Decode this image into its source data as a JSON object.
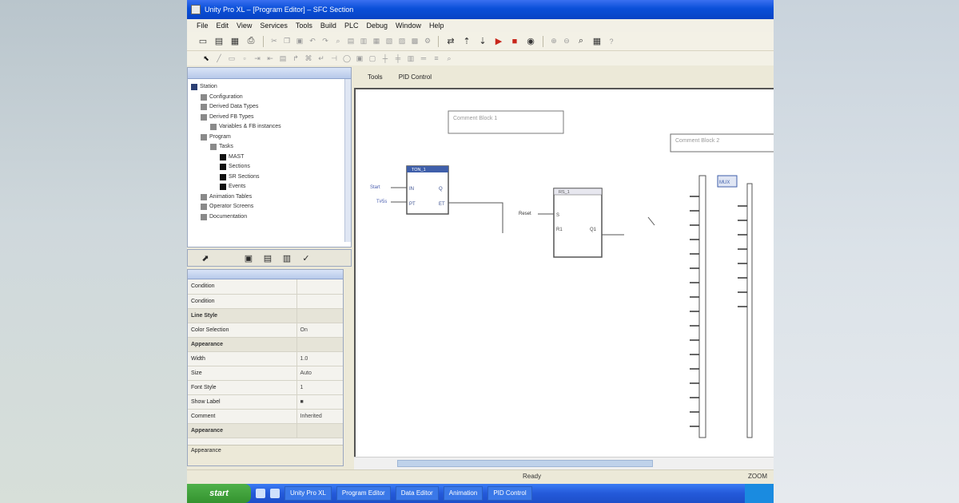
{
  "window": {
    "title": "Unity Pro XL – [Program Editor] – SFC Section"
  },
  "menu": [
    "File",
    "Edit",
    "View",
    "Services",
    "Tools",
    "Build",
    "PLC",
    "Debug",
    "Window",
    "Help"
  ],
  "toolbar1_icons": [
    "new-icon",
    "open-icon",
    "save-icon",
    "print-icon",
    "cut-icon",
    "copy-icon",
    "paste-icon",
    "undo-icon",
    "redo-icon",
    "build-icon",
    "connect-icon",
    "run-icon",
    "stop-icon",
    "animation-icon",
    "zoom-icon"
  ],
  "toolbar2_icons": [
    "select-icon",
    "link-icon",
    "block-icon",
    "variable-icon",
    "input-icon",
    "output-icon",
    "comment-icon",
    "jump-icon"
  ],
  "project_tree": {
    "items": [
      {
        "label": "Station",
        "depth": 0
      },
      {
        "label": "Configuration",
        "depth": 1
      },
      {
        "label": "Derived Data Types",
        "depth": 1
      },
      {
        "label": "Derived FB Types",
        "depth": 1
      },
      {
        "label": "Variables & FB instances",
        "depth": 2
      },
      {
        "label": "Program",
        "depth": 1
      },
      {
        "label": "Tasks",
        "depth": 2
      },
      {
        "label": "MAST",
        "depth": 3
      },
      {
        "label": "Sections",
        "depth": 3
      },
      {
        "label": "SR Sections",
        "depth": 3
      },
      {
        "label": "Events",
        "depth": 3
      },
      {
        "label": "Animation Tables",
        "depth": 1
      },
      {
        "label": "Operator Screens",
        "depth": 1
      },
      {
        "label": "Documentation",
        "depth": 1
      }
    ]
  },
  "properties": {
    "rows": [
      {
        "label": "Condition",
        "value": "",
        "group": false
      },
      {
        "label": "Condition",
        "value": "",
        "group": false
      },
      {
        "label": "Line Style",
        "value": "",
        "group": true
      },
      {
        "label": "Color Selection",
        "value": "On",
        "group": false
      },
      {
        "label": "Appearance",
        "value": "",
        "group": true
      },
      {
        "label": "Width",
        "value": "1.0",
        "group": false
      },
      {
        "label": "Size",
        "value": "Auto",
        "group": false
      },
      {
        "label": "Font Style",
        "value": "1",
        "group": false
      },
      {
        "label": "Show Label",
        "value": "■",
        "group": false
      },
      {
        "label": "Comment",
        "value": "Inherited",
        "group": false
      },
      {
        "label": "Appearance",
        "value": "",
        "group": true
      }
    ],
    "description": "Appearance"
  },
  "doc_tabs": [
    "Tools",
    "PID Control"
  ],
  "diagram": {
    "comment1": "Comment Block 1",
    "comment2": "Comment Block 2",
    "block1_title": "TON_1",
    "block2_title": "RS_1",
    "block3_title": "MUX",
    "block1_in": [
      "IN",
      "PT"
    ],
    "block1_out": [
      "Q",
      "ET"
    ],
    "block2_in": [
      "S",
      "R1"
    ],
    "block2_out": [
      "Q1"
    ],
    "block1_vars": [
      "Start",
      "T#5s"
    ],
    "block2_var": "Reset"
  },
  "status": {
    "text": "Ready",
    "right": "ZOOM"
  },
  "taskbar": {
    "start": "start",
    "items": [
      "Unity Pro XL",
      "Program Editor",
      "Data Editor",
      "Animation",
      "PID Control"
    ]
  }
}
